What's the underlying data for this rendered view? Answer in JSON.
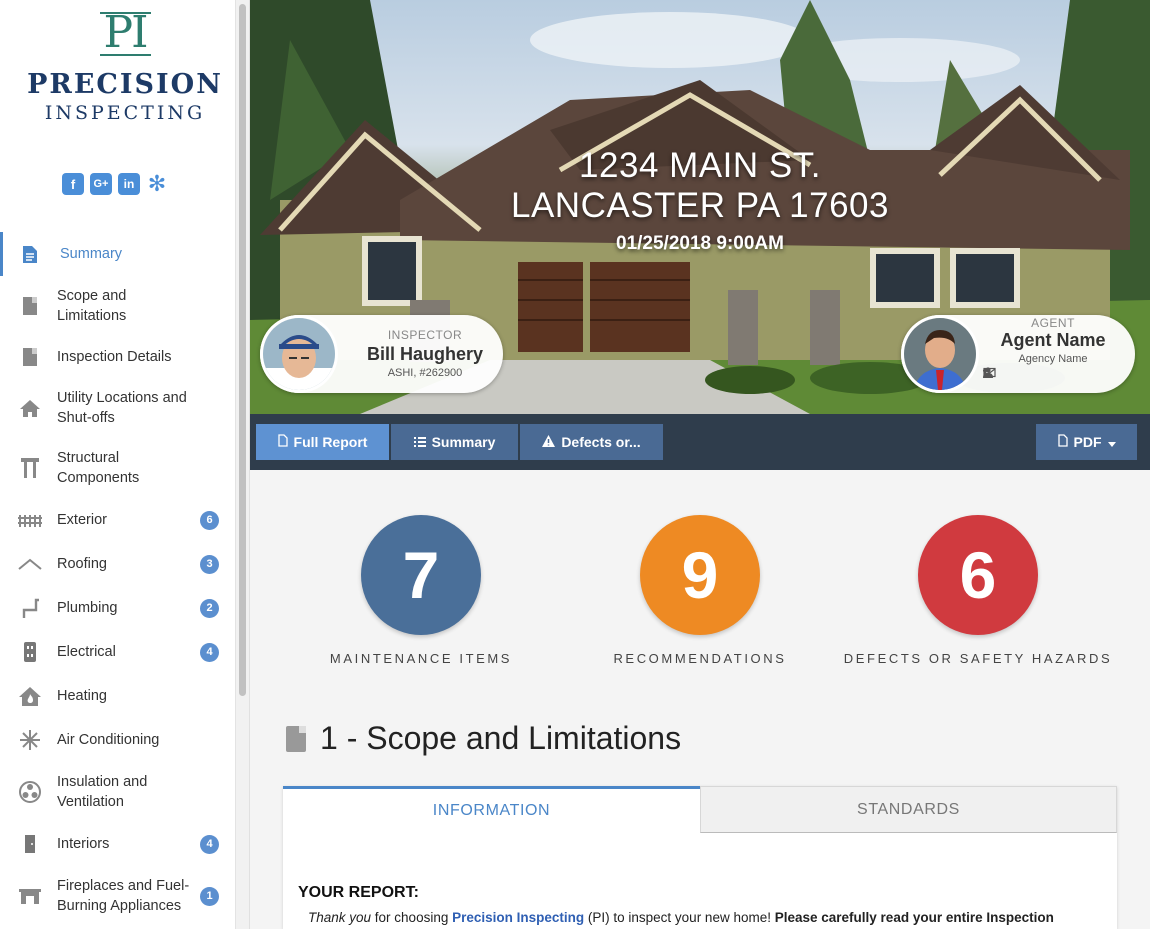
{
  "brand": {
    "mark": "PI",
    "name": "PRECISION",
    "sub": "INSPECTING"
  },
  "social": [
    {
      "name": "facebook-icon",
      "glyph": "f"
    },
    {
      "name": "google-plus-icon",
      "glyph": "G+"
    },
    {
      "name": "linkedin-icon",
      "glyph": "in"
    },
    {
      "name": "yelp-icon",
      "glyph": "✻"
    }
  ],
  "nav": [
    {
      "label": "Summary",
      "icon": "document-icon",
      "badge": ""
    },
    {
      "label": "Scope and Limitations",
      "icon": "book-icon",
      "badge": ""
    },
    {
      "label": "Inspection Details",
      "icon": "book-icon",
      "badge": ""
    },
    {
      "label": "Utility Locations and Shut-offs",
      "icon": "house-icon",
      "badge": ""
    },
    {
      "label": "Structural Components",
      "icon": "structure-icon",
      "badge": ""
    },
    {
      "label": "Exterior",
      "icon": "fence-icon",
      "badge": "6"
    },
    {
      "label": "Roofing",
      "icon": "roof-icon",
      "badge": "3"
    },
    {
      "label": "Plumbing",
      "icon": "pipe-icon",
      "badge": "2"
    },
    {
      "label": "Electrical",
      "icon": "outlet-icon",
      "badge": "4"
    },
    {
      "label": "Heating",
      "icon": "house-heat-icon",
      "badge": ""
    },
    {
      "label": "Air Conditioning",
      "icon": "snowflake-icon",
      "badge": ""
    },
    {
      "label": "Insulation and Ventilation",
      "icon": "fan-icon",
      "badge": ""
    },
    {
      "label": "Interiors",
      "icon": "door-icon",
      "badge": "4"
    },
    {
      "label": "Fireplaces and Fuel-Burning Appliances",
      "icon": "fireplace-icon",
      "badge": "1"
    }
  ],
  "hero": {
    "address_line1": "1234 MAIN ST.",
    "address_line2": "LANCASTER PA 17603",
    "datetime": "01/25/2018 9:00AM"
  },
  "inspector": {
    "role": "INSPECTOR",
    "name": "Bill Haughery",
    "credentials": "ASHI, #262900"
  },
  "agent": {
    "role": "AGENT",
    "name": "Agent Name",
    "agency": "Agency Name"
  },
  "toolbar": {
    "full_report": "Full Report",
    "summary": "Summary",
    "defects": "Defects or...",
    "pdf": "PDF"
  },
  "stats": [
    {
      "value": "7",
      "label": "MAINTENANCE ITEMS",
      "color": "#4a6f99"
    },
    {
      "value": "9",
      "label": "RECOMMENDATIONS",
      "color": "#ee8a23"
    },
    {
      "value": "6",
      "label": "DEFECTS OR SAFETY HAZARDS",
      "color": "#d03a3f"
    }
  ],
  "section": {
    "title": "1 - Scope and Limitations",
    "tabs": [
      "INFORMATION",
      "STANDARDS"
    ],
    "heading": "YOUR REPORT:",
    "intro_thank": "Thank you",
    "intro_mid": " for choosing ",
    "intro_brand": "Precision Inspecting",
    "intro_after": " (PI) to inspect your new home! ",
    "intro_bold": "Please carefully read your entire Inspection"
  }
}
